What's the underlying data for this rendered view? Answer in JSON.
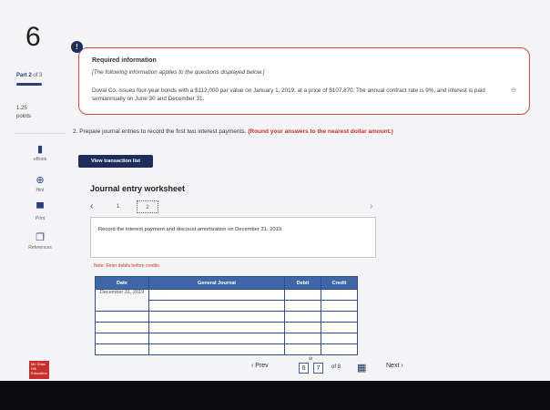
{
  "question": {
    "number": "6",
    "alert_icon": "!"
  },
  "part": {
    "label": "Part 2",
    "of": "of 3"
  },
  "points": {
    "value": "1.25",
    "unit": "points"
  },
  "side_tools": [
    {
      "label": "eBook",
      "icon": "book-icon"
    },
    {
      "label": "Hint",
      "icon": "lifebuoy-icon"
    },
    {
      "label": "Print",
      "icon": "printer-icon"
    },
    {
      "label": "References",
      "icon": "references-icon"
    }
  ],
  "required_info": {
    "title": "Required information",
    "intro": "[The following information applies to the questions displayed below.]",
    "body": "Duval Co. issues four-year bonds with a $112,000 par value on January 1, 2019, at a price of $107,870. The annual contract rate is 9%, and interest is paid semiannually on June 30 and December 31."
  },
  "prompt": {
    "text": "2. Prepare journal entries to record the first two interest payments.",
    "emphasis": "(Round your answers to the nearest dollar amount.)"
  },
  "view_transaction_button": "View transaction list",
  "worksheet": {
    "title": "Journal entry worksheet",
    "steps": [
      "1",
      "2"
    ],
    "instruction": "Record the interest payment and discount amortization on December 31, 2019.",
    "note": "Note: Enter debits before credits.",
    "columns": [
      "Date",
      "General Journal",
      "Debit",
      "Credit"
    ],
    "first_date": "December 31, 2019",
    "rows": 6
  },
  "bottom_nav": {
    "prev": "Prev",
    "pages": [
      "6",
      "7"
    ],
    "of": "of 8",
    "next": "Next"
  },
  "brand": {
    "logo": "Mc Graw Hill Education"
  },
  "colors": {
    "navy": "#1d2d5a",
    "table_header": "#3e66a8",
    "accent_red": "#c9302c"
  }
}
